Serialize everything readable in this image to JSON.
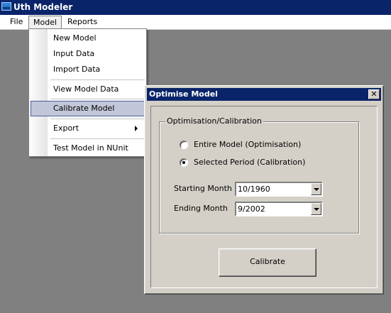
{
  "app": {
    "title": "Uth Modeler"
  },
  "menubar": {
    "file": "File",
    "model": "Model",
    "reports": "Reports"
  },
  "model_menu": {
    "items": [
      {
        "label": "New Model"
      },
      {
        "label": "Input Data"
      },
      {
        "label": "Import Data"
      },
      {
        "label": "View Model Data"
      },
      {
        "label": "Calibrate Model",
        "highlighted": true
      },
      {
        "label": "Export",
        "submenu": true
      },
      {
        "label": "Test Model in NUnit"
      }
    ]
  },
  "dialog": {
    "title": "Optimise Model",
    "close_glyph": "✕",
    "group_label": "Optimisation/Calibration",
    "options": [
      {
        "label": "Entire Model (Optimisation)",
        "checked": false
      },
      {
        "label": "Selected Period (Calibration)",
        "checked": true
      }
    ],
    "starting_month_label": "Starting Month",
    "starting_month_value": "10/1960",
    "ending_month_label": "Ending Month",
    "ending_month_value": "9/2002",
    "calibrate_label": "Calibrate"
  }
}
